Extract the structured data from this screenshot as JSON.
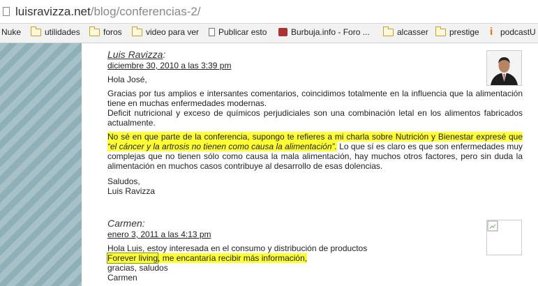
{
  "address_bar": {
    "url_host": "luisravizza.net",
    "url_path": "/blog/conferencias-2/"
  },
  "bookmarks": [
    {
      "label": "Nuke",
      "icon": "none"
    },
    {
      "label": "utilidades",
      "icon": "folder-icon"
    },
    {
      "label": "foros",
      "icon": "folder-icon"
    },
    {
      "label": "video para ver",
      "icon": "folder-icon"
    },
    {
      "label": "Publicar esto",
      "icon": "page-icon"
    },
    {
      "label": "Burbuja.info - Foro ...",
      "icon": "burbuja-icon"
    },
    {
      "label": "alcasser",
      "icon": "folder-icon"
    },
    {
      "label": "prestige",
      "icon": "folder-icon"
    },
    {
      "label": "podcastU",
      "icon": "podcast-icon"
    }
  ],
  "comments": [
    {
      "author": "Luis Ravizza",
      "author_suffix": ":",
      "date": "diciembre 30, 2010 a las 3:39 pm",
      "greeting": "Hola José,",
      "p1": "Gracias por tus amplios e intersantes comentarios, coincidimos totalmente en la influencia que la alimentación tiene en muchas enfermedades modernas.",
      "p2": "Deficit nutricional y exceso de químicos perjudiciales son una combinación letal en los alimentos fabricados actualmente.",
      "p3_highlight": "No sé en que parte de la conferencia, supongo te refieres a mi charla sobre Nutrición y Bienestar expresé que",
      "p3_quote": "“el cáncer y la artrosis no tienen como causa la alimentación”.",
      "p3_rest": " Lo que sí es claro es que son enfermedades muy complejas que no tienen sólo como causa la mala alimentación, hay muchos otros factores, pero sin duda la alimentación en muchos casos contribuye al desarrollo de esas dolencias.",
      "closing": "Saludos,",
      "signature": "Luis Ravizza"
    },
    {
      "author": "Carmen",
      "author_suffix": ":",
      "date": "enero 3, 2011 a las 4:13 pm",
      "line1": "Hola Luis, estoy interesada en el consumo y distribución de productos",
      "line2_boxed": "Forever living",
      "line2_rest": ", me encantaría recibir más información,",
      "line3": "gracias, saludos",
      "line4": "Carmen"
    }
  ]
}
